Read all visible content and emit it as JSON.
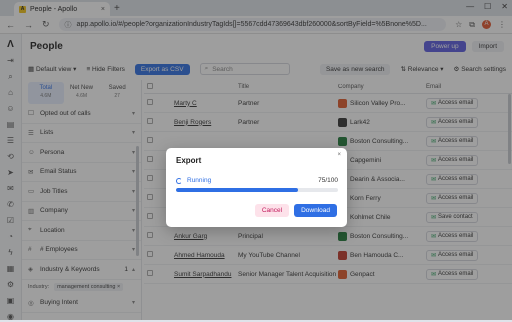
{
  "browser": {
    "tab_title": "People - Apollo",
    "tab_close": "×",
    "new_tab": "+",
    "url": "app.apollo.io/#/people?organizationIndustryTagIds[]=5567cdd47369643dbf260000&sortByField=%5Bnone%5D...",
    "profile_initial": "A"
  },
  "header": {
    "title": "People",
    "power_up": "Power up",
    "import": "Import"
  },
  "toolbar": {
    "default_view": "Default view",
    "hide_filters": "Hide Filters",
    "export_csv": "Export as CSV",
    "search_placeholder": "Search",
    "save_search": "Save as new search",
    "relevance": "Relevance",
    "search_settings": "Search settings"
  },
  "segments": [
    {
      "label": "Total",
      "count": "4.6M"
    },
    {
      "label": "Net New",
      "count": "4.6M"
    },
    {
      "label": "Saved",
      "count": "27"
    }
  ],
  "filters": [
    "Opted out of calls",
    "Lists",
    "Persona",
    "Email Status",
    "Job Titles",
    "Company",
    "Location",
    "# Employees",
    "Industry & Keywords",
    "Buying Intent"
  ],
  "industry_chip": {
    "label": "Industry:",
    "value": "management consulting",
    "count": "1"
  },
  "table": {
    "headers": {
      "name": "",
      "title": "Title",
      "company": "Company",
      "email": "Email"
    },
    "rows": [
      {
        "name": "Marty C",
        "title": "Partner",
        "company": "Silicon Valley Pro...",
        "email": "Access email",
        "color": "#e05a2b"
      },
      {
        "name": "Benji Rogers",
        "title": "Partner",
        "company": "Lark42",
        "email": "Access email",
        "color": "#333333"
      },
      {
        "name": "",
        "title": "",
        "company": "Boston Consulting...",
        "email": "Access email",
        "color": "#1f7a3a"
      },
      {
        "name": "",
        "title": "",
        "company": "Capgemini",
        "email": "Access email",
        "color": "#1a73e8"
      },
      {
        "name": "",
        "title": "",
        "company": "Dearin & Associa...",
        "email": "Access email",
        "color": "#c0392b"
      },
      {
        "name": "",
        "title": "",
        "company": "Korn Ferry",
        "email": "Access email",
        "color": "#0f7b5f"
      },
      {
        "name": "Ivan Koehler",
        "title": "Gerente Propietario",
        "company": "Kohlmet Chile",
        "email": "Save contact",
        "color": "#c0392b"
      },
      {
        "name": "Ankur Garg",
        "title": "Principal",
        "company": "Boston Consulting...",
        "email": "Access email",
        "color": "#1f7a3a"
      },
      {
        "name": "Ahmed Hamouda",
        "title": "My YouTube Channel",
        "company": "Ben Hamouda C...",
        "email": "Access email",
        "color": "#c0392b"
      },
      {
        "name": "Sumit Sarpadhandu",
        "title": "Senior Manager Talent Acquisition",
        "company": "Genpact",
        "email": "Access email",
        "color": "#e05a2b"
      }
    ]
  },
  "modal": {
    "title": "Export",
    "close": "×",
    "status": "Running",
    "progress_text": "75/100",
    "progress": 0.75,
    "cancel": "Cancel",
    "download": "Download"
  }
}
